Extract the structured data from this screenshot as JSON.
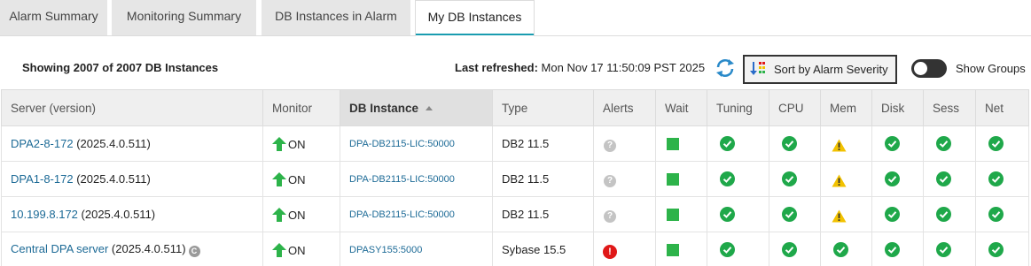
{
  "tabs": [
    {
      "label": "Alarm Summary",
      "active": false
    },
    {
      "label": "Monitoring Summary",
      "active": false
    },
    {
      "label": "DB Instances in Alarm",
      "active": false
    },
    {
      "label": "My DB Instances",
      "active": true
    }
  ],
  "toolbar": {
    "showing": "Showing 2007 of 2007 DB Instances",
    "refreshed_label": "Last refreshed:",
    "refreshed_value": "Mon Nov 17 11:50:09 PST 2025",
    "sort_label": "Sort by Alarm Severity",
    "show_groups_label": "Show Groups",
    "show_groups_on": false
  },
  "table": {
    "columns": [
      "Server (version)",
      "Monitor",
      "DB Instance",
      "Type",
      "Alerts",
      "Wait",
      "Tuning",
      "CPU",
      "Mem",
      "Disk",
      "Sess",
      "Net"
    ],
    "sorted_column": "DB Instance",
    "sort_direction": "ascending",
    "rows": [
      {
        "server": "DPA2-8-172",
        "version": "(2025.4.0.511)",
        "central": false,
        "monitor": "ON",
        "db_instance": "DPA-DB2115-LIC:50000",
        "type": "DB2 11.5",
        "alerts": "unknown",
        "wait": "ok",
        "tuning": "ok",
        "cpu": "ok",
        "mem": "warning",
        "disk": "ok",
        "sess": "ok",
        "net": "ok"
      },
      {
        "server": "DPA1-8-172",
        "version": "(2025.4.0.511)",
        "central": false,
        "monitor": "ON",
        "db_instance": "DPA-DB2115-LIC:50000",
        "type": "DB2 11.5",
        "alerts": "unknown",
        "wait": "ok",
        "tuning": "ok",
        "cpu": "ok",
        "mem": "warning",
        "disk": "ok",
        "sess": "ok",
        "net": "ok"
      },
      {
        "server": "10.199.8.172",
        "version": "(2025.4.0.511)",
        "central": false,
        "monitor": "ON",
        "db_instance": "DPA-DB2115-LIC:50000",
        "type": "DB2 11.5",
        "alerts": "unknown",
        "wait": "ok",
        "tuning": "ok",
        "cpu": "ok",
        "mem": "warning",
        "disk": "ok",
        "sess": "ok",
        "net": "ok"
      },
      {
        "server": "Central DPA server",
        "version": "(2025.4.0.511)",
        "central": true,
        "central_badge": "C",
        "monitor": "ON",
        "db_instance": "DPASY155:5000",
        "type": "Sybase 15.5",
        "alerts": "critical",
        "wait": "ok",
        "tuning": "ok",
        "cpu": "ok",
        "mem": "ok",
        "disk": "ok",
        "sess": "ok",
        "net": "ok"
      }
    ]
  },
  "icons": {
    "unknown_glyph": "?",
    "critical_glyph": "!"
  },
  "colors": {
    "accent": "#1a9cb0",
    "link": "#1c6a96",
    "ok": "#1fa84a",
    "warning": "#f2c200",
    "critical": "#e01818",
    "monitor_up": "#2db34a"
  }
}
